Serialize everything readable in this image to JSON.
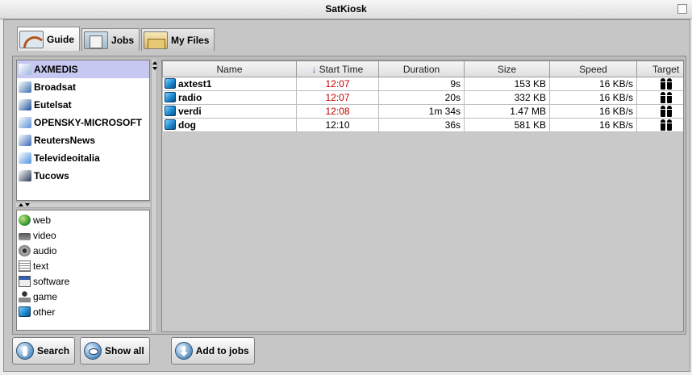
{
  "window": {
    "title": "SatKiosk"
  },
  "tabs": [
    {
      "label": "Guide",
      "icon": "guide-icon",
      "active": true
    },
    {
      "label": "Jobs",
      "icon": "jobs-icon",
      "active": false
    },
    {
      "label": "My Files",
      "icon": "my-files-icon",
      "active": false
    }
  ],
  "channels": [
    {
      "label": "AXMEDIS",
      "logo": "axmedis-logo",
      "selected": true,
      "color": "#9bb7e0"
    },
    {
      "label": "Broadsat",
      "logo": "broadsat-logo",
      "selected": false,
      "color": "#3b6fb0"
    },
    {
      "label": "Eutelsat",
      "logo": "eutelsat-logo",
      "selected": false,
      "color": "#1d4f9a"
    },
    {
      "label": "OPENSKY-MICROSOFT",
      "logo": "opensky-logo",
      "selected": false,
      "color": "#5a8fd6"
    },
    {
      "label": "ReutersNews",
      "logo": "reuters-logo",
      "selected": false,
      "color": "#3a68b8"
    },
    {
      "label": "Televideoitalia",
      "logo": "televideoitalia-logo",
      "selected": false,
      "color": "#4f91e0"
    },
    {
      "label": "Tucows",
      "logo": "tucows-logo",
      "selected": false,
      "color": "#2a3a55"
    }
  ],
  "categories": [
    {
      "label": "web",
      "icon": "globe-icon"
    },
    {
      "label": "video",
      "icon": "video-camera-icon"
    },
    {
      "label": "audio",
      "icon": "speaker-icon"
    },
    {
      "label": "text",
      "icon": "text-document-icon"
    },
    {
      "label": "software",
      "icon": "software-icon"
    },
    {
      "label": "game",
      "icon": "joystick-icon"
    },
    {
      "label": "other",
      "icon": "cube-icon"
    }
  ],
  "table": {
    "columns": [
      "Name",
      "Start Time",
      "Duration",
      "Size",
      "Speed",
      "Target"
    ],
    "sort_indicator": "↓",
    "rows": [
      {
        "name": "axtest1",
        "start": "12:07",
        "duration": "9s",
        "size": "153 KB",
        "speed": "16 KB/s",
        "target": "group-target-icon",
        "start_color": "#c00000"
      },
      {
        "name": "radio",
        "start": "12:07",
        "duration": "20s",
        "size": "332 KB",
        "speed": "16 KB/s",
        "target": "group-target-icon",
        "start_color": "#c00000"
      },
      {
        "name": "verdi",
        "start": "12:08",
        "duration": "1m 34s",
        "size": "1.47 MB",
        "speed": "16 KB/s",
        "target": "group-target-icon",
        "start_color": "#c00000"
      },
      {
        "name": "dog",
        "start": "12:10",
        "duration": "36s",
        "size": "581 KB",
        "speed": "16 KB/s",
        "target": "group-target-icon",
        "start_color": "#000000"
      }
    ]
  },
  "buttons": {
    "search": "Search",
    "show_all": "Show all",
    "add_to_jobs": "Add to jobs"
  }
}
